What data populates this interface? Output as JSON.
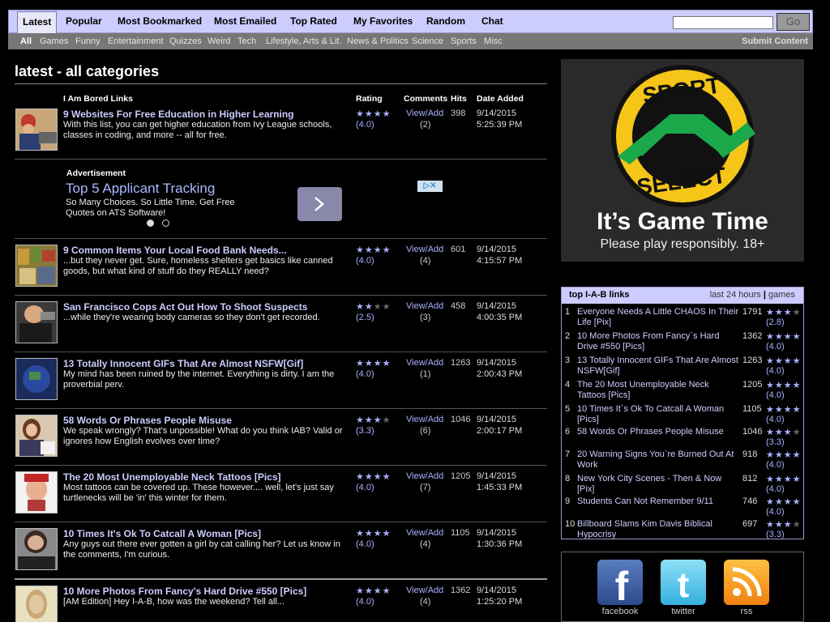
{
  "nav": {
    "tabs": [
      "Latest",
      "Popular",
      "Most Bookmarked",
      "Most Emailed",
      "Top Rated",
      "My Favorites",
      "Random",
      "Chat"
    ],
    "active_tab": "Latest",
    "search_placeholder": "",
    "go_label": "Go"
  },
  "subnav": {
    "categories": [
      "All",
      "Games",
      "Funny",
      "Entertainment",
      "Quizzes",
      "Weird",
      "Tech",
      "Lifestyle, Arts & Lit.",
      "News & Politics",
      "Science",
      "Sports",
      "Misc"
    ],
    "active": "All",
    "submit": "Submit Content"
  },
  "main": {
    "title": "latest - all categories",
    "columns": {
      "links": "I Am Bored Links",
      "rating": "Rating",
      "comments": "Comments",
      "hits": "Hits",
      "date": "Date Added"
    },
    "items": [
      {
        "title": "9 Websites For Free Education in Higher Learning",
        "desc": "With this list, you can get higher education from Ivy League schools, classes in coding, and more -- all for free.",
        "rating": "(4.0)",
        "stars": 4,
        "view": "View/Add",
        "comments": "(2)",
        "hits": "398",
        "date": "9/14/2015",
        "time": "5:25:39 PM"
      },
      {
        "title": "9 Common Items Your Local Food Bank Needs...",
        "desc": "...but they never get. Sure, homeless shelters get basics like canned goods, but what kind of stuff do they REALLY need?",
        "rating": "(4.0)",
        "stars": 4,
        "view": "View/Add",
        "comments": "(4)",
        "hits": "601",
        "date": "9/14/2015",
        "time": "4:15:57 PM"
      },
      {
        "title": "San Francisco Cops Act Out How To Shoot Suspects",
        "desc": "...while they're wearing body cameras so they don't get recorded.",
        "rating": "(2.5)",
        "stars": 2,
        "view": "View/Add",
        "comments": "(3)",
        "hits": "458",
        "date": "9/14/2015",
        "time": "4:00:35 PM"
      },
      {
        "title": "13 Totally Innocent GIFs That Are Almost NSFW[Gif]",
        "desc": "My mind has been ruined by the internet. Everything is dirty. I am the proverbial perv.",
        "rating": "(4.0)",
        "stars": 4,
        "view": "View/Add",
        "comments": "(1)",
        "hits": "1263",
        "date": "9/14/2015",
        "time": "2:00:43 PM"
      },
      {
        "title": "58 Words Or Phrases People Misuse",
        "desc": "We speak wrongly? That's unpossible! What do you think IAB? Valid or ignores how English evolves over time?",
        "rating": "(3.3)",
        "stars": 3,
        "view": "View/Add",
        "comments": "(6)",
        "hits": "1046",
        "date": "9/14/2015",
        "time": "2:00:17 PM"
      },
      {
        "title": "The 20 Most Unemployable Neck Tattoos [Pics]",
        "desc": "Most tattoos can be covered up. These however.... well, let's just say turtlenecks will be 'in' this winter for them.",
        "rating": "(4.0)",
        "stars": 4,
        "view": "View/Add",
        "comments": "(7)",
        "hits": "1205",
        "date": "9/14/2015",
        "time": "1:45:33 PM"
      },
      {
        "title": "10 Times It's Ok To Catcall A Woman [Pics]",
        "desc": "Any guys out there ever gotten a girl by cat calling her? Let us know in the comments, I'm curious.",
        "rating": "(4.0)",
        "stars": 4,
        "view": "View/Add",
        "comments": "(4)",
        "hits": "1105",
        "date": "9/14/2015",
        "time": "1:30:36 PM"
      },
      {
        "title": "10 More Photos From Fancy's Hard Drive #550 [Pics]",
        "desc": "[AM Edition] Hey I-A-B, how was the weekend? Tell all...",
        "rating": "(4.0)",
        "stars": 4,
        "view": "View/Add",
        "comments": "(4)",
        "hits": "1362",
        "date": "9/14/2015",
        "time": "1:25:20 PM"
      }
    ]
  },
  "ad": {
    "label": "Advertisement",
    "title": "Top 5 Applicant Tracking",
    "desc": "So Many Choices. So Little Time. Get Free Quotes on ATS Software!"
  },
  "banner": {
    "brand_top": "SPORT",
    "brand_bottom": "SELECT",
    "headline": "It’s Game Time",
    "sub": "Please play responsibly. 18+"
  },
  "toplinks": {
    "title": "top I-A-B links",
    "range": "last 24 hours",
    "sep": "|",
    "games": "games",
    "items": [
      {
        "n": "1",
        "title": "Everyone Needs A Little CHAOS In Their Life [Pix]",
        "hits": "1791",
        "stars": 3,
        "rating": "(2.8)"
      },
      {
        "n": "2",
        "title": "10 More Photos From Fancy`s Hard Drive #550 [Pics]",
        "hits": "1362",
        "stars": 4,
        "rating": "(4.0)"
      },
      {
        "n": "3",
        "title": "13 Totally Innocent GIFs That Are Almost NSFW[Gif]",
        "hits": "1263",
        "stars": 4,
        "rating": "(4.0)"
      },
      {
        "n": "4",
        "title": "The 20 Most Unemployable Neck Tattoos [Pics]",
        "hits": "1205",
        "stars": 4,
        "rating": "(4.0)"
      },
      {
        "n": "5",
        "title": "10 Times It`s Ok To Catcall A Woman [Pics]",
        "hits": "1105",
        "stars": 4,
        "rating": "(4.0)"
      },
      {
        "n": "6",
        "title": "58 Words Or Phrases People Misuse",
        "hits": "1046",
        "stars": 3,
        "rating": "(3.3)"
      },
      {
        "n": "7",
        "title": "20 Warning Signs You`re Burned Out At Work",
        "hits": "918",
        "stars": 4,
        "rating": "(4.0)"
      },
      {
        "n": "8",
        "title": "New York City Scenes - Then & Now [Pix]",
        "hits": "812",
        "stars": 4,
        "rating": "(4.0)"
      },
      {
        "n": "9",
        "title": "Students Can Not Remember 9/11",
        "hits": "746",
        "stars": 4,
        "rating": "(4.0)"
      },
      {
        "n": "10",
        "title": "Billboard Slams Kim Davis Biblical Hypocrisy",
        "hits": "697",
        "stars": 3,
        "rating": "(3.3)"
      }
    ]
  },
  "social": {
    "facebook": "facebook",
    "twitter": "twitter",
    "rss": "rss"
  },
  "colors": {
    "nav_bg": "#ccccff",
    "link": "#ccccff",
    "star": "#aab0ff",
    "subnav_bg": "#777777",
    "banner_green": "#1aa84a",
    "banner_yellow": "#f5c518"
  }
}
